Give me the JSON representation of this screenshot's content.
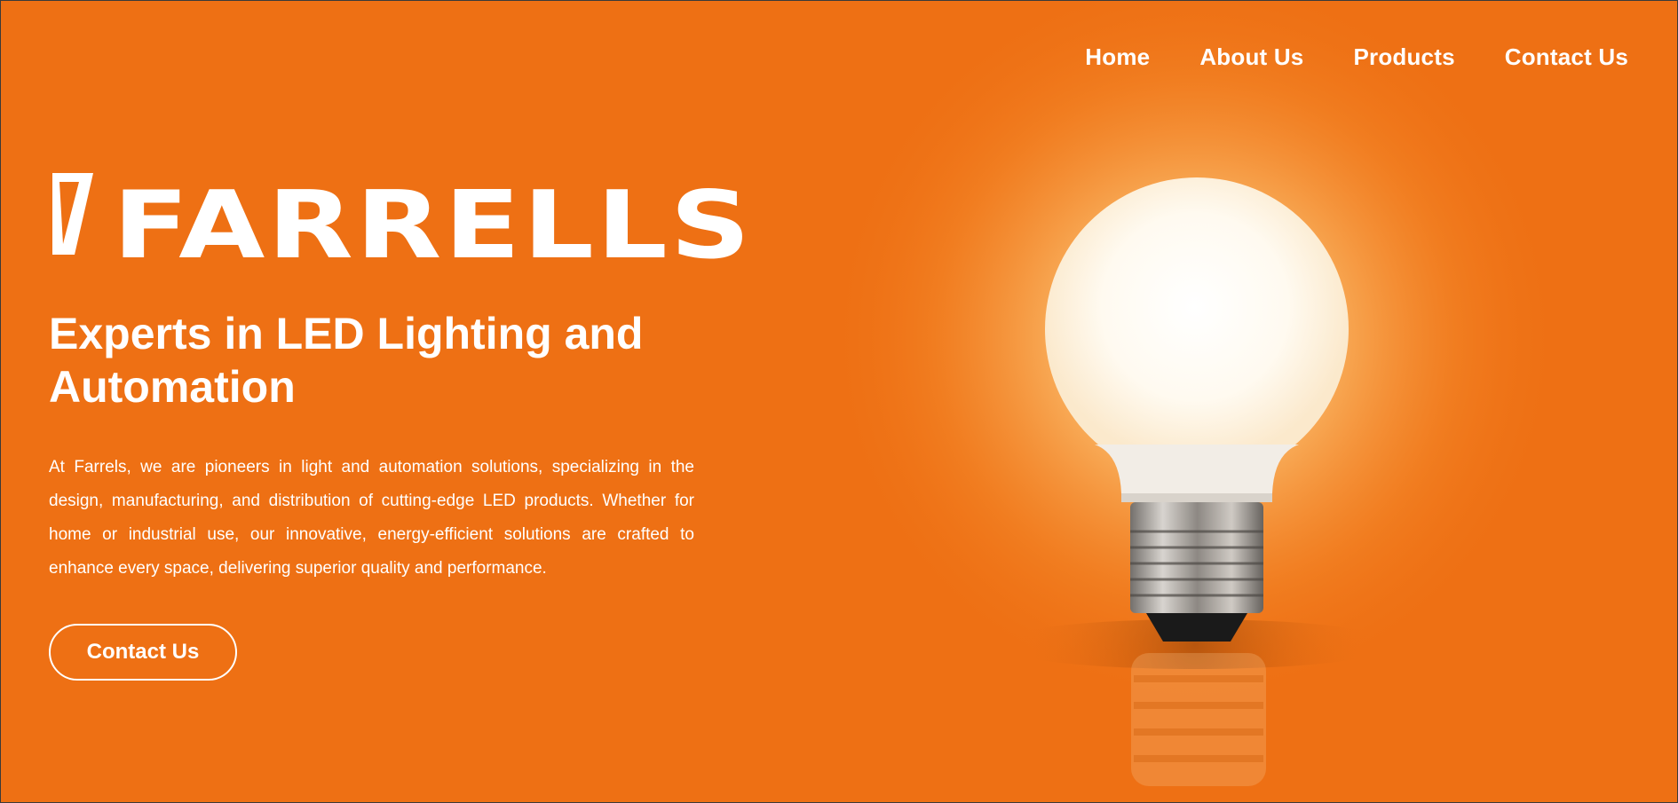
{
  "nav": {
    "items": [
      {
        "label": "Home"
      },
      {
        "label": "About Us"
      },
      {
        "label": "Products"
      },
      {
        "label": "Contact Us"
      }
    ]
  },
  "brand": {
    "name": "FARRELLS"
  },
  "hero": {
    "headline": "Experts in LED Lighting and Automation",
    "description": "At Farrels, we are pioneers in light and automation solutions, specializing in the design, manufacturing, and distribution of cutting-edge LED products. Whether for home or industrial use, our innovative, energy-efficient solutions are crafted to enhance every space, delivering superior quality and performance.",
    "cta_label": "Contact Us",
    "image": "light-bulb-icon"
  },
  "colors": {
    "background": "#ee7014",
    "text": "#ffffff"
  }
}
